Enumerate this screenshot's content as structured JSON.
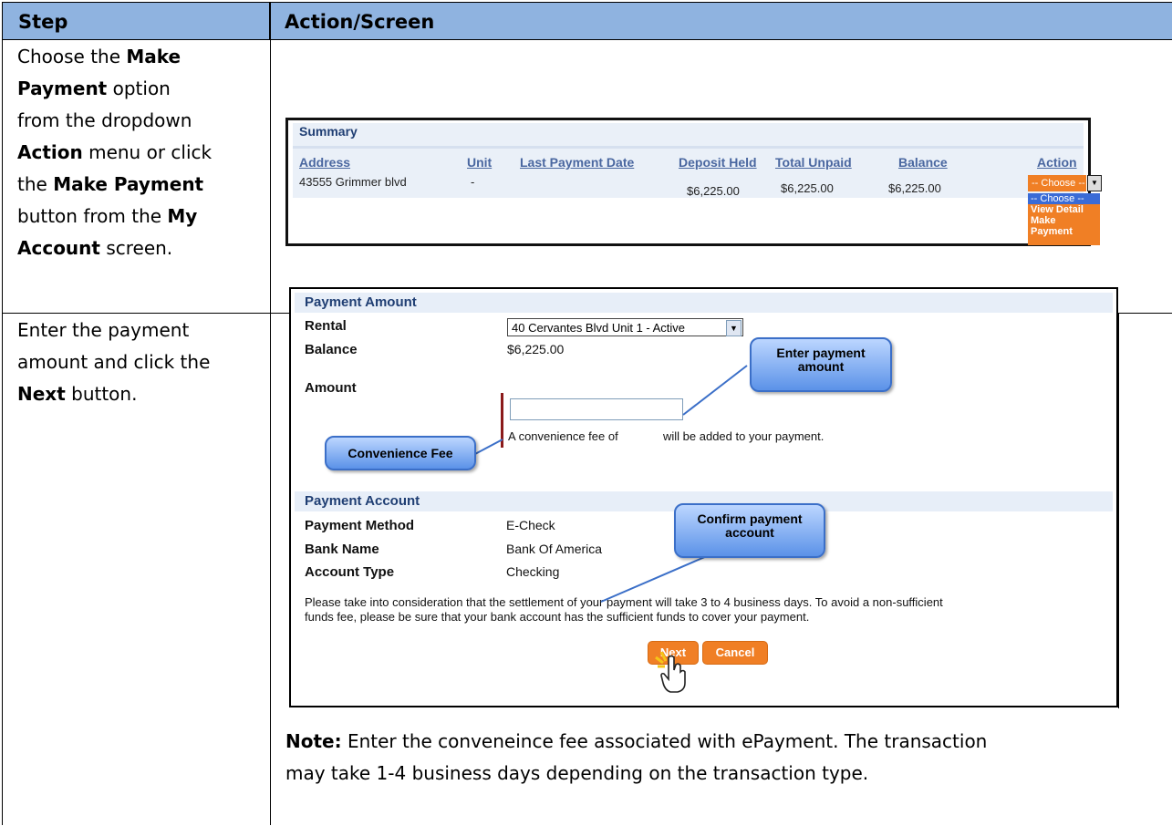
{
  "table": {
    "header_step": "Step",
    "header_action": "Action/Screen"
  },
  "step1": {
    "t1": "Choose the ",
    "b1": "Make",
    "b2": "Payment",
    "t2": " option",
    "t3": "from the dropdown",
    "b3": "Action",
    "t4": " menu or click",
    "t5": "the ",
    "b4": "Make Payment",
    "t6": "button from the ",
    "b5": "My",
    "b6": "Account",
    "t7": " screen."
  },
  "step2": {
    "t1": "Enter the payment",
    "t2": "amount and click the",
    "b1": "Next",
    "t3": " button."
  },
  "summary": {
    "title": "Summary",
    "columns": [
      "Address",
      "Unit",
      "Last Payment Date",
      "Deposit Held",
      "Total Unpaid",
      "Balance",
      "Action"
    ],
    "row": {
      "address": "43555 Grimmer blvd",
      "unit": "-",
      "last_payment_date": "",
      "deposit_held": "$6,225.00",
      "total_unpaid": "$6,225.00",
      "balance": "$6,225.00"
    },
    "action_selected": "-- Choose --",
    "action_options": [
      "-- Choose --",
      "View Detail",
      "Make Payment"
    ]
  },
  "payment": {
    "amount_header": "Payment Amount",
    "rental_label": "Rental",
    "rental_value": "40 Cervantes Blvd Unit 1 - Active",
    "balance_label": "Balance",
    "balance_value": "$6,225.00",
    "amount_label": "Amount",
    "amount_value": "",
    "fee_text_a": "A convenience fee of",
    "fee_text_b": "will be added to your payment.",
    "account_header": "Payment Account",
    "method_label": "Payment Method",
    "method_value": "E-Check",
    "bank_label": "Bank Name",
    "bank_value": "Bank Of America",
    "type_label": "Account Type",
    "type_value": "Checking",
    "disclaimer_1": "Please take into consideration that the settlement of your payment will take 3 to 4 business days. To avoid a non-sufficient",
    "disclaimer_2": "funds fee, please be sure that your bank account has the sufficient funds to cover your payment.",
    "next_label": "Next",
    "cancel_label": "Cancel"
  },
  "callouts": {
    "enter_amount_1": "Enter payment",
    "enter_amount_2": "amount",
    "convenience_fee": "Convenience Fee",
    "confirm_account_1": "Confirm payment",
    "confirm_account_2": "account"
  },
  "note": {
    "label": "Note:",
    "line1": "  Enter the conveneince fee associated with ePayment.  The transaction",
    "line2": "may take 1-4 business days depending on the transaction type."
  },
  "colors": {
    "header_bg": "#8fb3e0",
    "accent_orange": "#f07f25",
    "callout_blue": "#5b92e8"
  }
}
